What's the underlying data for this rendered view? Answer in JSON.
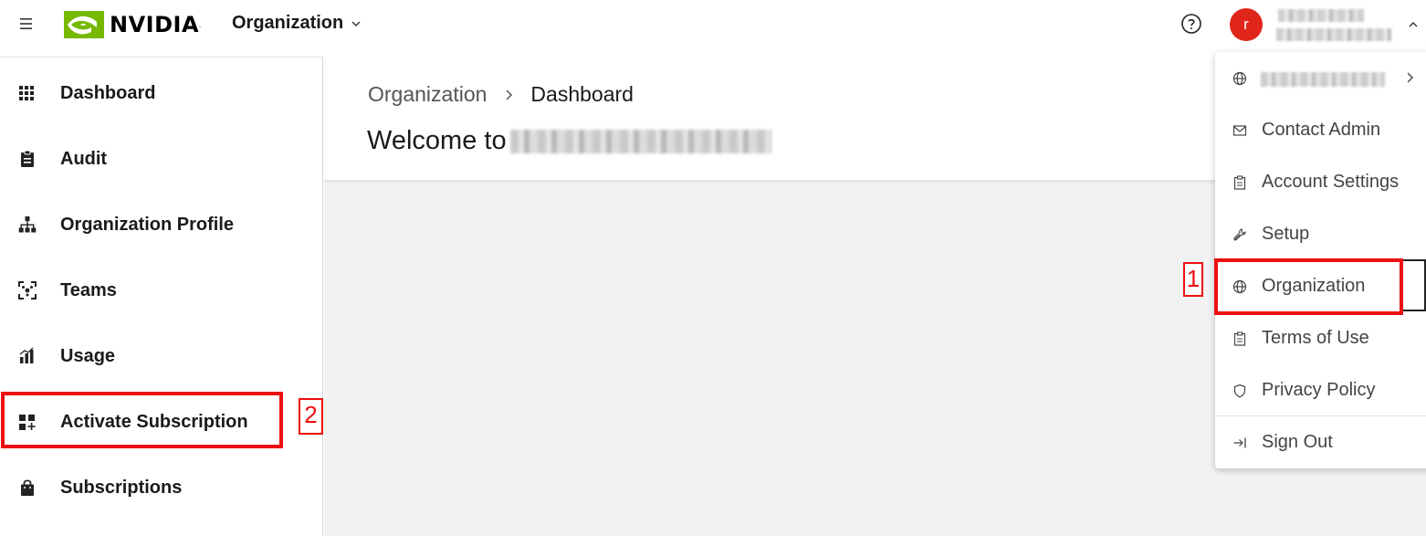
{
  "header": {
    "brand": "NVIDIA",
    "org_selector": "Organization",
    "help_icon": "help-circle-icon",
    "avatar_initial": "r",
    "menu_icon": "hamburger-icon"
  },
  "sidebar": {
    "items": [
      {
        "label": "Dashboard",
        "icon": "grid-icon"
      },
      {
        "label": "Audit",
        "icon": "clipboard-icon"
      },
      {
        "label": "Organization Profile",
        "icon": "org-chart-icon"
      },
      {
        "label": "Teams",
        "icon": "team-focus-icon"
      },
      {
        "label": "Usage",
        "icon": "bar-chart-icon"
      },
      {
        "label": "Activate Subscription",
        "icon": "add-widget-icon"
      },
      {
        "label": "Subscriptions",
        "icon": "shopping-bag-icon"
      }
    ]
  },
  "main": {
    "breadcrumb": {
      "parent": "Organization",
      "current": "Dashboard"
    },
    "welcome_prefix": "Welcome to"
  },
  "user_menu": {
    "items": [
      {
        "label": "Contact Admin",
        "icon": "mail-icon"
      },
      {
        "label": "Account Settings",
        "icon": "clipboard-icon"
      },
      {
        "label": "Setup",
        "icon": "wrench-icon"
      },
      {
        "label": "Organization",
        "icon": "globe-icon"
      },
      {
        "label": "Terms of Use",
        "icon": "clipboard-icon"
      },
      {
        "label": "Privacy Policy",
        "icon": "shield-icon"
      },
      {
        "label": "Sign Out",
        "icon": "sign-out-icon"
      }
    ]
  },
  "annotations": {
    "label_1": "1",
    "label_2": "2",
    "color": "#ee0f0f"
  },
  "colors": {
    "nvidia_green": "#76b900",
    "avatar_red": "#e0251b"
  }
}
